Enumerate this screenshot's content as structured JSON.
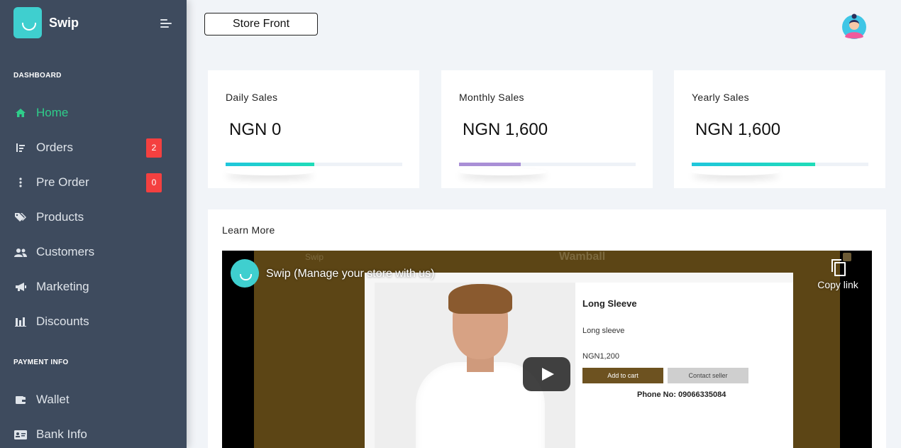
{
  "brand": {
    "name": "Swip"
  },
  "sidebar": {
    "sections": [
      {
        "label": "DASHBOARD"
      },
      {
        "label": "PAYMENT INFO"
      }
    ],
    "items": [
      {
        "label": "Home",
        "icon": "home-icon"
      },
      {
        "label": "Orders",
        "icon": "orders-icon",
        "badge": "2"
      },
      {
        "label": "Pre Order",
        "icon": "pre-order-icon",
        "badge": "0"
      },
      {
        "label": "Products",
        "icon": "tags-icon"
      },
      {
        "label": "Customers",
        "icon": "users-icon"
      },
      {
        "label": "Marketing",
        "icon": "megaphone-icon"
      },
      {
        "label": "Discounts",
        "icon": "discount-icon"
      },
      {
        "label": "Wallet",
        "icon": "wallet-icon"
      },
      {
        "label": "Bank Info",
        "icon": "id-card-icon"
      }
    ]
  },
  "header": {
    "store_front_label": "Store Front"
  },
  "stats": [
    {
      "title": "Daily Sales",
      "value": "NGN 0",
      "progress": 0.5,
      "color": "#1fd0c8"
    },
    {
      "title": "Monthly Sales",
      "value": "NGN 1,600",
      "progress": 0.35,
      "color": "#a98fd6"
    },
    {
      "title": "Yearly Sales",
      "value": "NGN 1,600",
      "progress": 0.7,
      "color": "#1fd0c8"
    }
  ],
  "learn_more": {
    "title": "Learn More",
    "video": {
      "title": "Swip (Manage your store with us)",
      "copy_link": "Copy link",
      "store_name_left": "Swip",
      "store_name_center": "Wamball",
      "product_name": "Long Sleeve",
      "product_desc": "Long sleeve",
      "price": "NGN1,200",
      "add_to_cart": "Add to cart",
      "contact_seller": "Contact seller",
      "phone": "Phone No: 09066335084"
    }
  },
  "colors": {
    "sidebar_bg": "#3e4b5e",
    "active": "#2fcd8a",
    "badge": "#f44040"
  }
}
